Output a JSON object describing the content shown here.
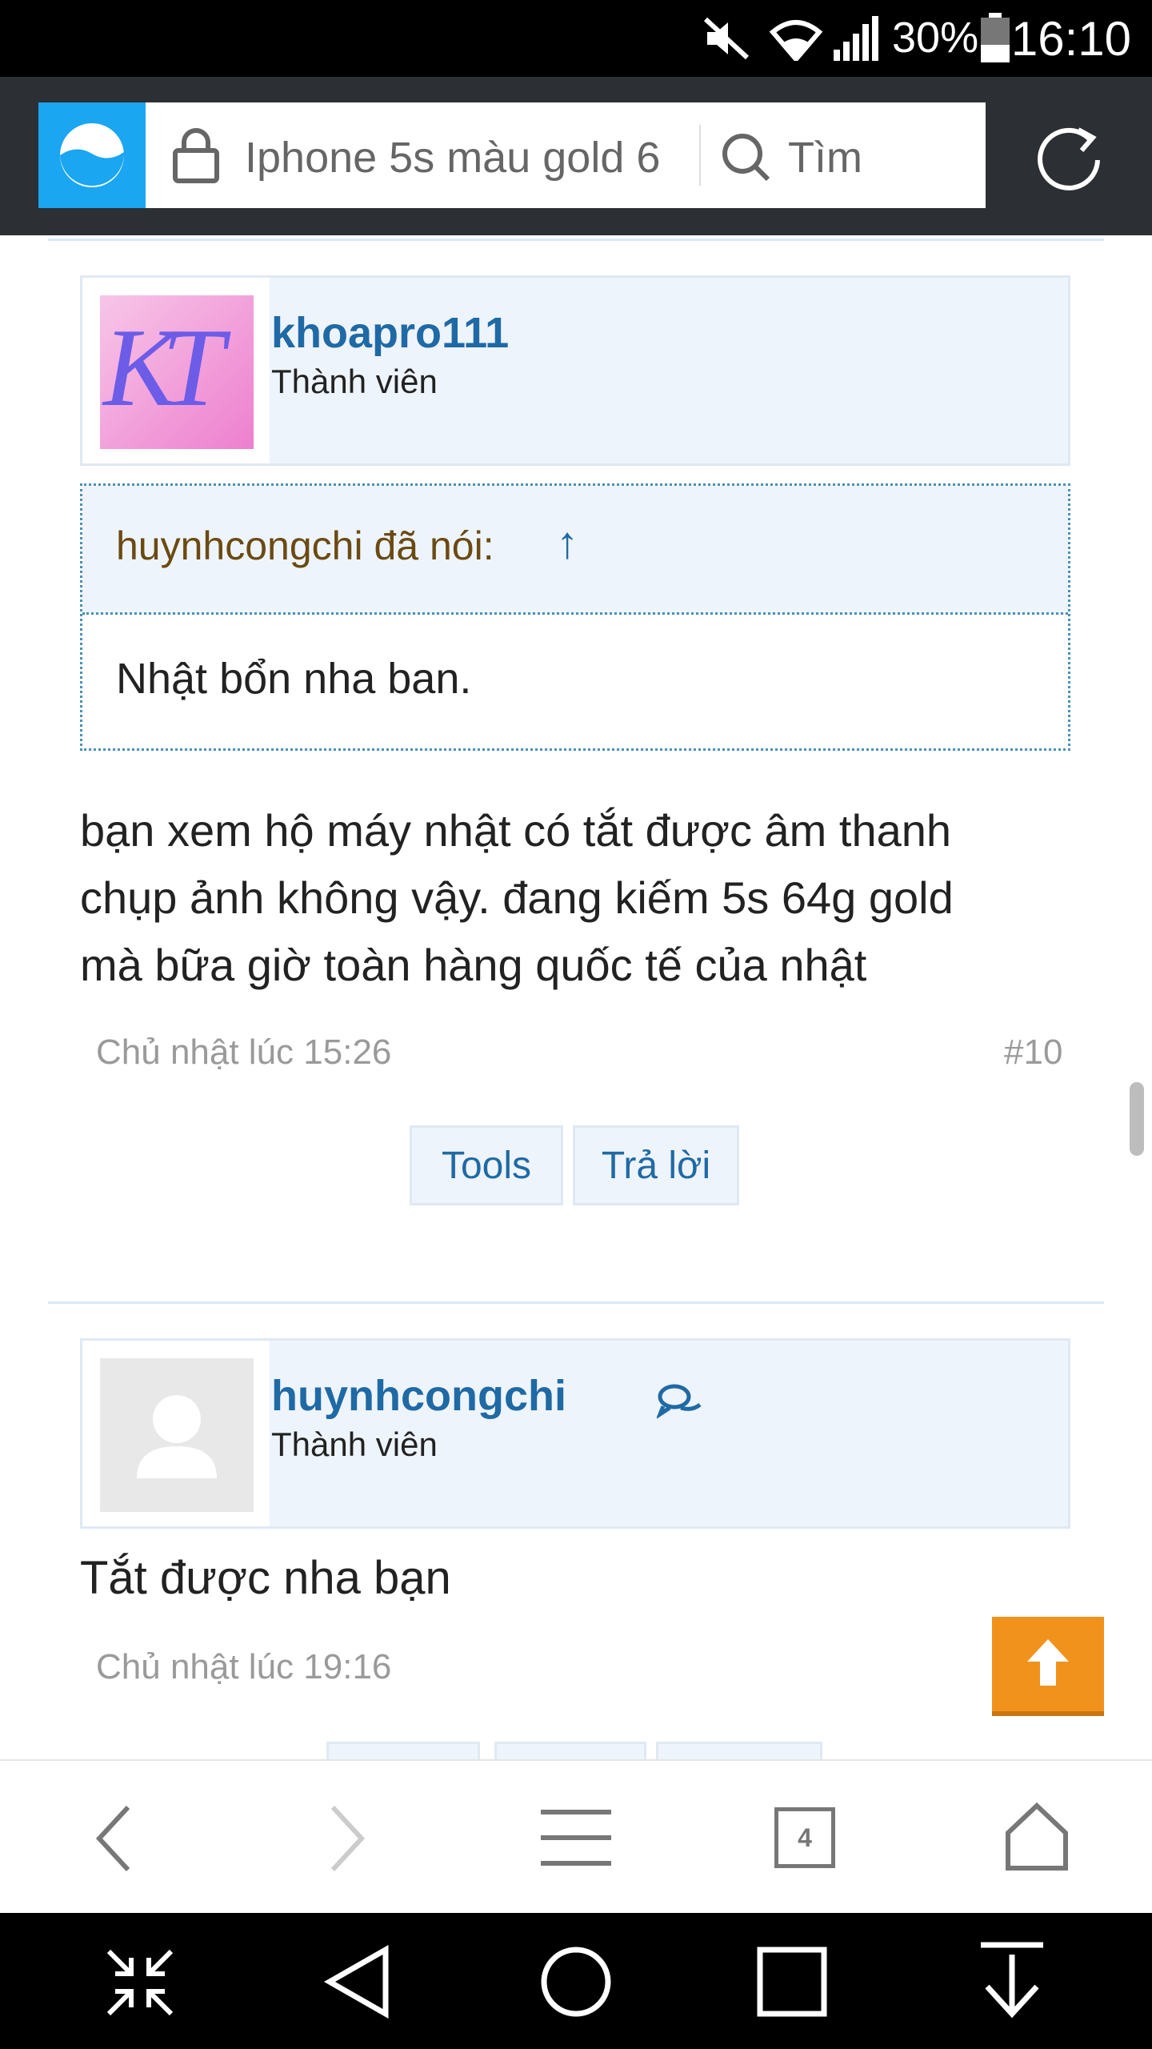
{
  "status_bar": {
    "battery_percent": "30%",
    "time": "16:10",
    "icons": [
      "muted-icon",
      "wifi-icon",
      "signal-icon",
      "battery-icon"
    ]
  },
  "browser": {
    "url_text": "Iphone 5s màu gold 6",
    "search_label": "Tìm",
    "tab_count": "4",
    "colors": {
      "logo_bg": "#1aa6f1",
      "toolbar_bg": "#2c2f33"
    }
  },
  "posts": [
    {
      "username": "khoapro111",
      "role": "Thành viên",
      "avatar_letters": "KT",
      "quote": {
        "author": "huynhcongchi đã nói:",
        "arrow": "↑",
        "text": "Nhật bổn nha ban."
      },
      "body_lines": [
        "bạn xem hộ máy nhật có tắt được âm thanh",
        "chụp ảnh không vậy. đang kiếm 5s 64g gold",
        "mà bữa giờ toàn hàng quốc tế của nhật"
      ],
      "date": "Chủ nhật lúc 15:26",
      "number": "#10",
      "buttons": {
        "tools": "Tools",
        "reply": "Trả lời"
      }
    },
    {
      "username": "huynhcongchi",
      "role": "Thành viên",
      "body": "Tắt được nha bạn",
      "date": "Chủ nhật lúc 19:16"
    }
  ],
  "colors": {
    "link": "#1f6aa5",
    "quote_author": "#6b4a12",
    "back_to_top": "#f0921c"
  }
}
